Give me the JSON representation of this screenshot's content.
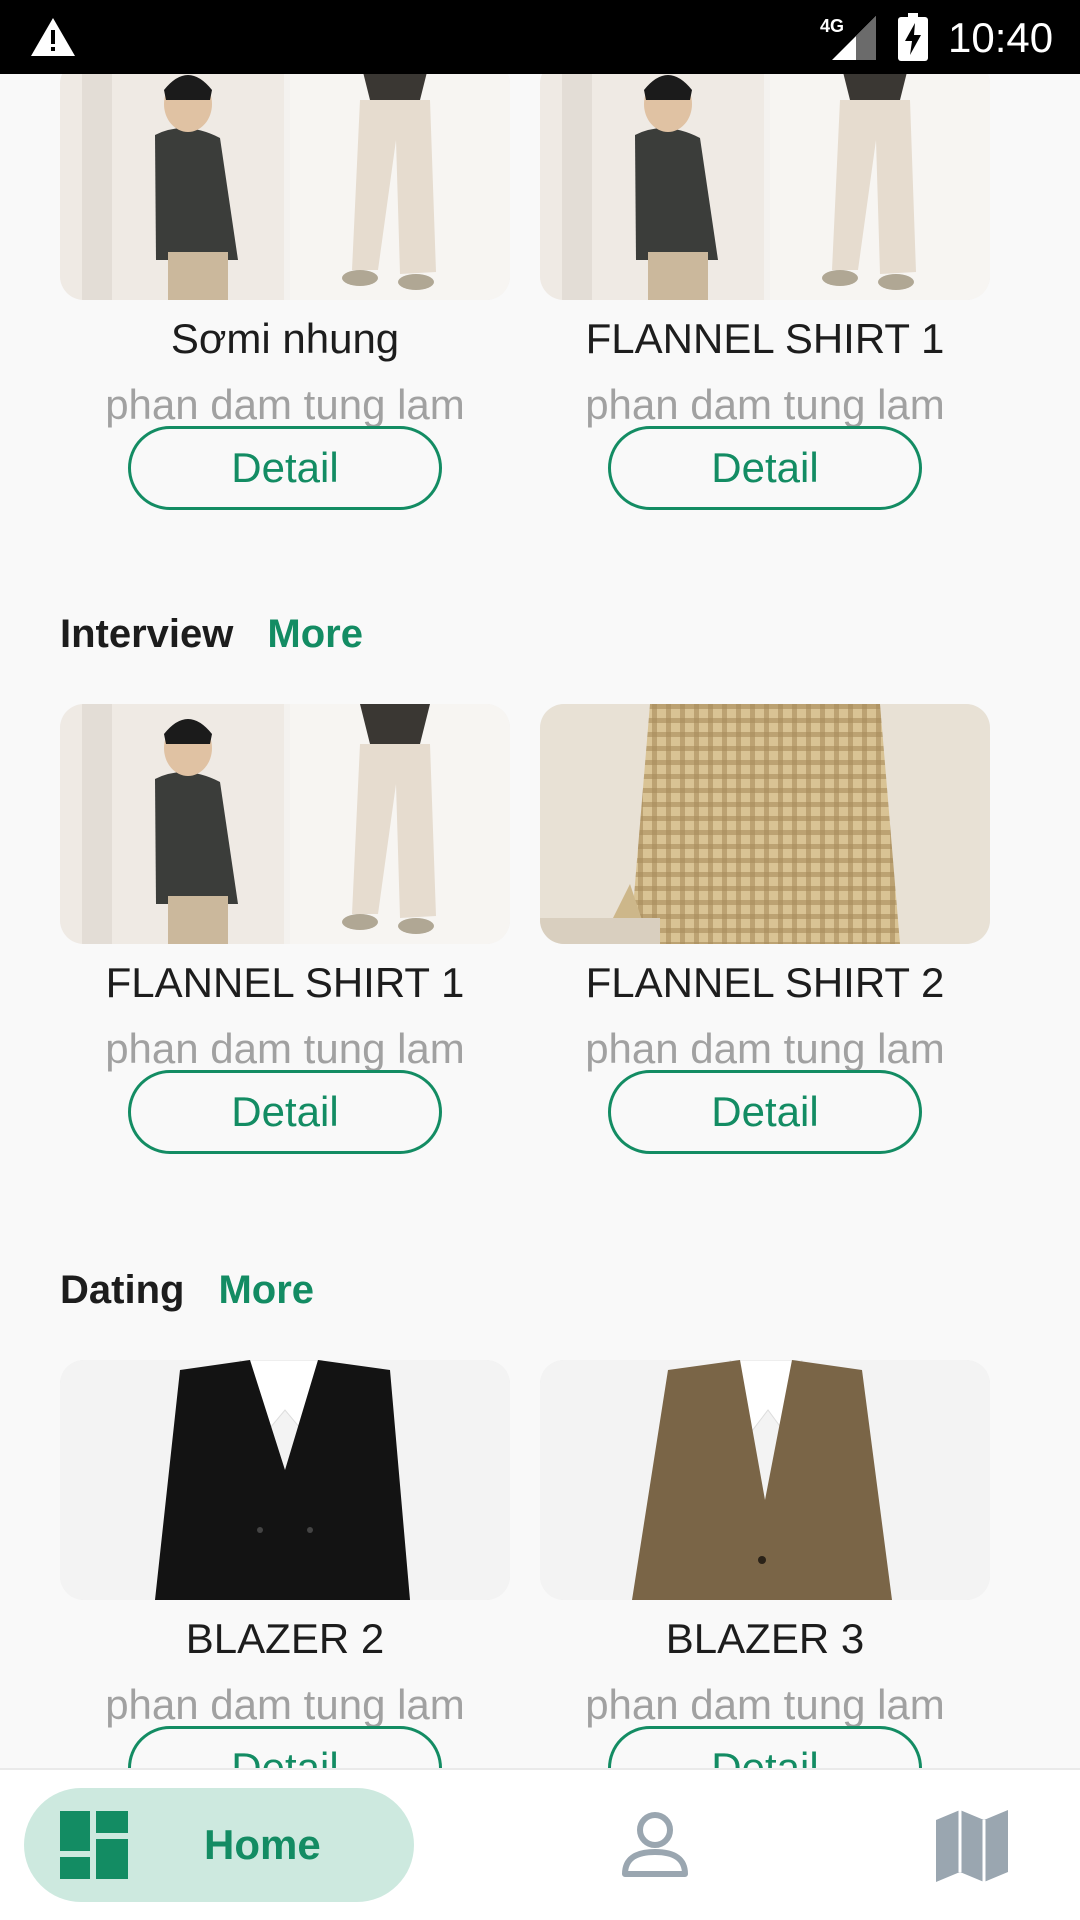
{
  "status_bar": {
    "network": "4G",
    "time": "10:40"
  },
  "sections": [
    {
      "cards": [
        {
          "title": "Sơmi nhung",
          "author": "phan dam tung lam",
          "button": "Detail",
          "image": "two-photo-collage"
        },
        {
          "title": "FLANNEL SHIRT 1",
          "author": "phan dam tung lam",
          "button": "Detail",
          "image": "two-photo-collage"
        }
      ]
    },
    {
      "title": "Interview",
      "more": "More",
      "cards": [
        {
          "title": "FLANNEL SHIRT 1",
          "author": "phan dam tung lam",
          "button": "Detail",
          "image": "two-photo-collage"
        },
        {
          "title": "FLANNEL SHIRT 2",
          "author": "phan dam tung lam",
          "button": "Detail",
          "image": "checked-shirt-photo"
        }
      ]
    },
    {
      "title": "Dating",
      "more": "More",
      "cards": [
        {
          "title": "BLAZER 2",
          "author": "phan dam tung lam",
          "button": "Detail",
          "image": "black-blazer-photo"
        },
        {
          "title": "BLAZER 3",
          "author": "phan dam tung lam",
          "button": "Detail",
          "image": "brown-blazer-photo"
        }
      ]
    }
  ],
  "bottom_nav": {
    "home_label": "Home",
    "items": [
      "dashboard-icon",
      "person-icon",
      "map-icon"
    ]
  },
  "colors": {
    "accent": "#138c63",
    "accent_light": "#cde9df",
    "subtitle": "#a1a1a1",
    "background": "#f9f9f9"
  }
}
